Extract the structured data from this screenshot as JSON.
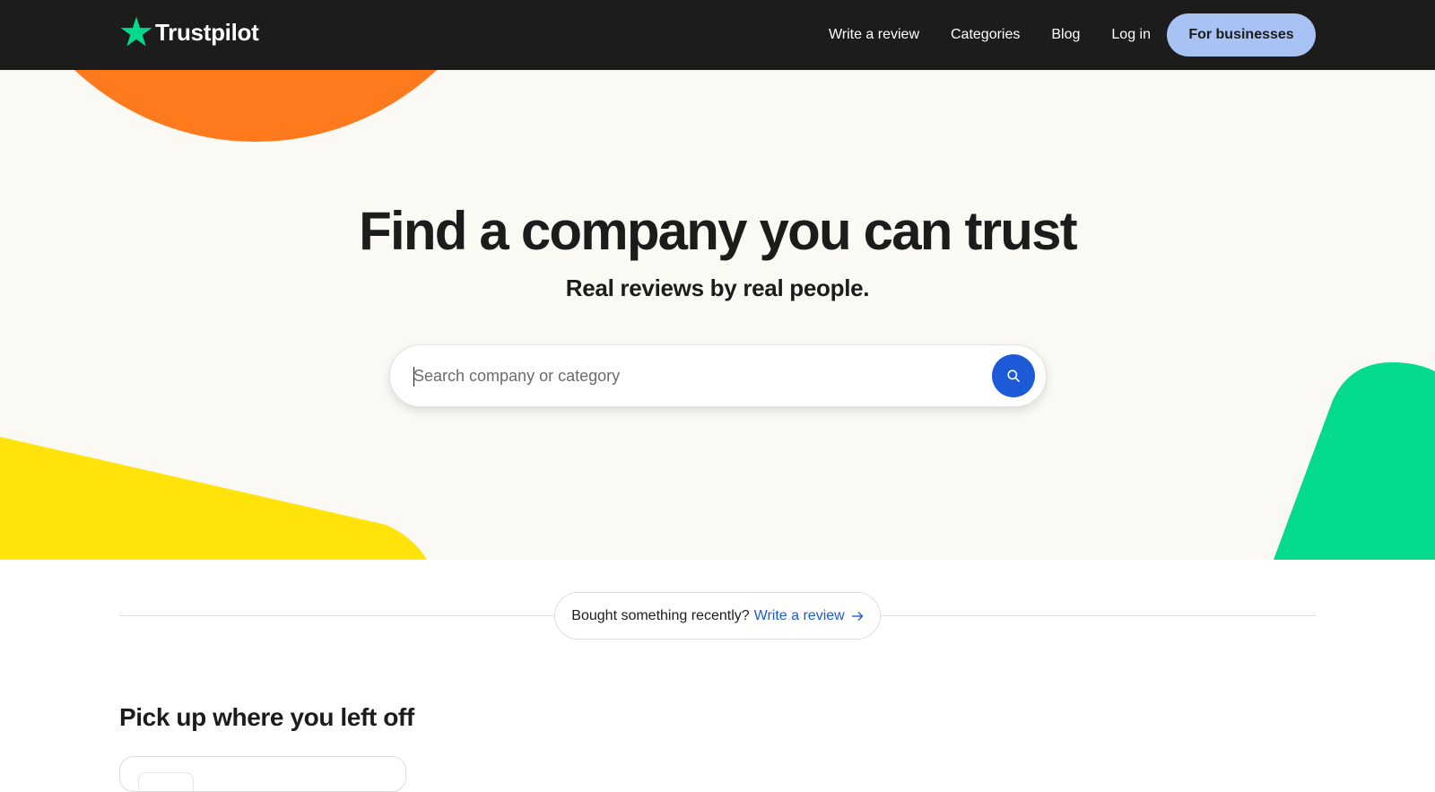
{
  "header": {
    "logo_text": "Trustpilot",
    "nav": [
      {
        "label": "Write a review"
      },
      {
        "label": "Categories"
      },
      {
        "label": "Blog"
      },
      {
        "label": "Log in"
      }
    ],
    "business_button": "For businesses"
  },
  "hero": {
    "title": "Find a company you can trust",
    "subtitle": "Real reviews by real people.",
    "search": {
      "placeholder": "Search company or category",
      "value": ""
    }
  },
  "banner": {
    "text": "Bought something recently?",
    "link": "Write a review"
  },
  "recent": {
    "title": "Pick up where you left off"
  },
  "icons": {
    "logo": "star-icon",
    "search": "search-icon",
    "arrow": "arrow-right-icon"
  },
  "colors": {
    "header_bg": "#1c1c1c",
    "hero_bg": "#faf9f4",
    "brand_green": "#04da8d",
    "business_button": "#a9c2f4",
    "search_button": "#1d5ad8",
    "link": "#1d5ad8",
    "decor_orange": "#ff7a1c",
    "decor_yellow": "#ffe30a",
    "decor_green": "#04da8d"
  }
}
